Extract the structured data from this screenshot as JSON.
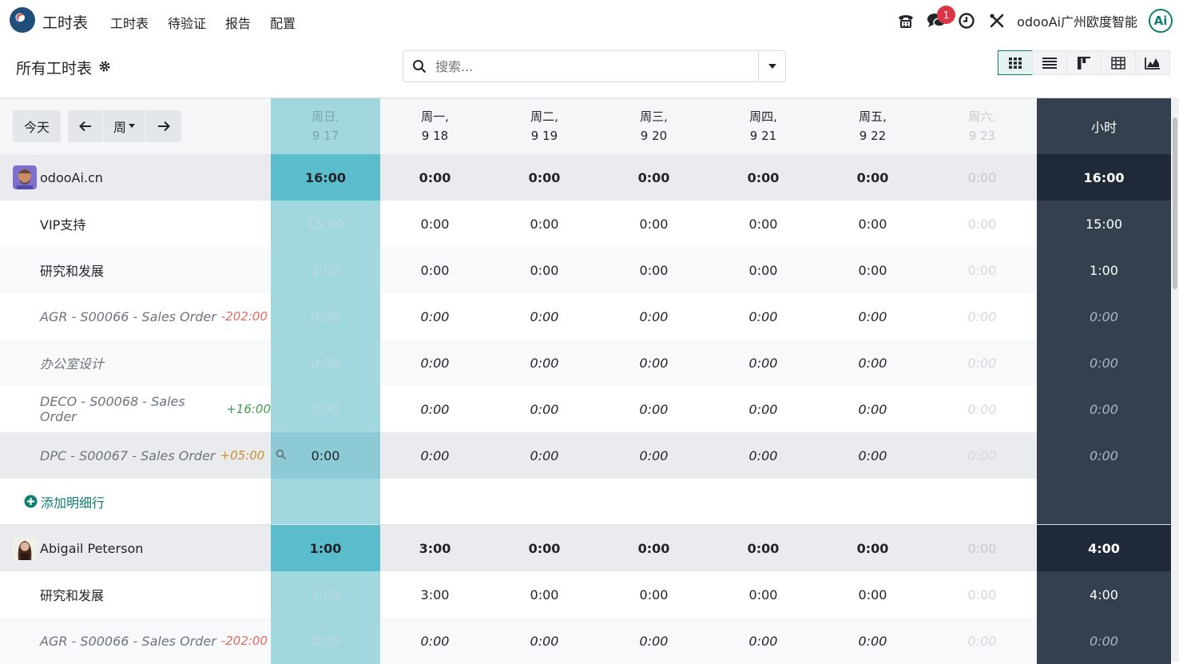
{
  "topbar": {
    "app_title": "工时表",
    "menu": [
      "工时表",
      "待验证",
      "报告",
      "配置"
    ],
    "messages_badge": "1",
    "company": "odooAi广州欧度智能",
    "avatar_letter": "Ai"
  },
  "control": {
    "breadcrumb": "所有工时表",
    "search_placeholder": "搜索..."
  },
  "grid": {
    "today_button": "今天",
    "period_button": "周",
    "columns": [
      {
        "day": "周日,",
        "date": "9 17"
      },
      {
        "day": "周一,",
        "date": "9 18"
      },
      {
        "day": "周二,",
        "date": "9 19"
      },
      {
        "day": "周三,",
        "date": "9 20"
      },
      {
        "day": "周四,",
        "date": "9 21"
      },
      {
        "day": "周五,",
        "date": "9 22"
      },
      {
        "day": "周六,",
        "date": "9 23"
      }
    ],
    "total_header": "小时",
    "rows": [
      {
        "name": "odooAi.cn",
        "values": [
          "16:00",
          "0:00",
          "0:00",
          "0:00",
          "0:00",
          "0:00",
          "0:00"
        ],
        "total": "16:00"
      },
      {
        "name": "VIP支持",
        "values": [
          "15:00",
          "0:00",
          "0:00",
          "0:00",
          "0:00",
          "0:00",
          "0:00"
        ],
        "total": "15:00"
      },
      {
        "name": "研究和发展",
        "values": [
          "1:00",
          "0:00",
          "0:00",
          "0:00",
          "0:00",
          "0:00",
          "0:00"
        ],
        "total": "1:00"
      },
      {
        "name": "AGR - S00066 - Sales Order",
        "tag": "-202:00",
        "values": [
          "0:00",
          "0:00",
          "0:00",
          "0:00",
          "0:00",
          "0:00",
          "0:00"
        ],
        "total": "0:00"
      },
      {
        "name": "办公室设计",
        "values": [
          "0:00",
          "0:00",
          "0:00",
          "0:00",
          "0:00",
          "0:00",
          "0:00"
        ],
        "total": "0:00"
      },
      {
        "name": "DECO - S00068 - Sales Order",
        "tag": "+16:00",
        "values": [
          "0:00",
          "0:00",
          "0:00",
          "0:00",
          "0:00",
          "0:00",
          "0:00"
        ],
        "total": "0:00"
      },
      {
        "name": "DPC - S00067 - Sales Order",
        "tag": "+05:00",
        "values": [
          "0:00",
          "0:00",
          "0:00",
          "0:00",
          "0:00",
          "0:00",
          "0:00"
        ],
        "total": "0:00"
      },
      {
        "add_label": "添加明细行"
      },
      {
        "name": "Abigail Peterson",
        "values": [
          "1:00",
          "3:00",
          "0:00",
          "0:00",
          "0:00",
          "0:00",
          "0:00"
        ],
        "total": "4:00"
      },
      {
        "name": "研究和发展",
        "values": [
          "1:00",
          "3:00",
          "0:00",
          "0:00",
          "0:00",
          "0:00",
          "0:00"
        ],
        "total": "4:00"
      },
      {
        "name": "AGR - S00066 - Sales Order",
        "tag": "-202:00",
        "values": [
          "0:00",
          "0:00",
          "0:00",
          "0:00",
          "0:00",
          "0:00",
          "0:00"
        ],
        "total": "0:00"
      }
    ]
  }
}
